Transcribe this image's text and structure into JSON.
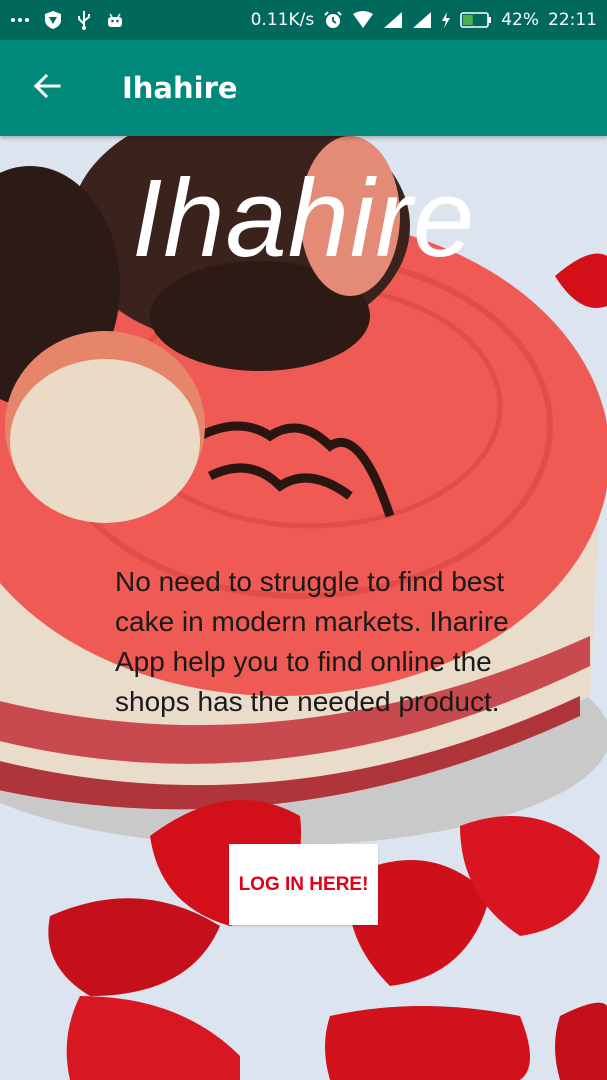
{
  "status_bar": {
    "network_speed": "0.11K/s",
    "battery_percent": "42%",
    "time": "22:11",
    "icons": [
      "more-dots-icon",
      "vpn-icon",
      "usb-icon",
      "android-icon",
      "alarm-icon",
      "wifi-icon",
      "signal-icon",
      "signal-icon",
      "charging-icon",
      "battery-icon"
    ],
    "battery_level": 0.42
  },
  "app_bar": {
    "title": "Ihahire",
    "back_icon": "arrow-left-icon",
    "color": "#00897b"
  },
  "hero": {
    "title": "Ihahire",
    "description": "No need to struggle to find best cake in modern markets. Iharire App help you to find online the shops has the needed product.",
    "login_label": "LOG IN HERE!",
    "accent_color": "#e1001a"
  }
}
